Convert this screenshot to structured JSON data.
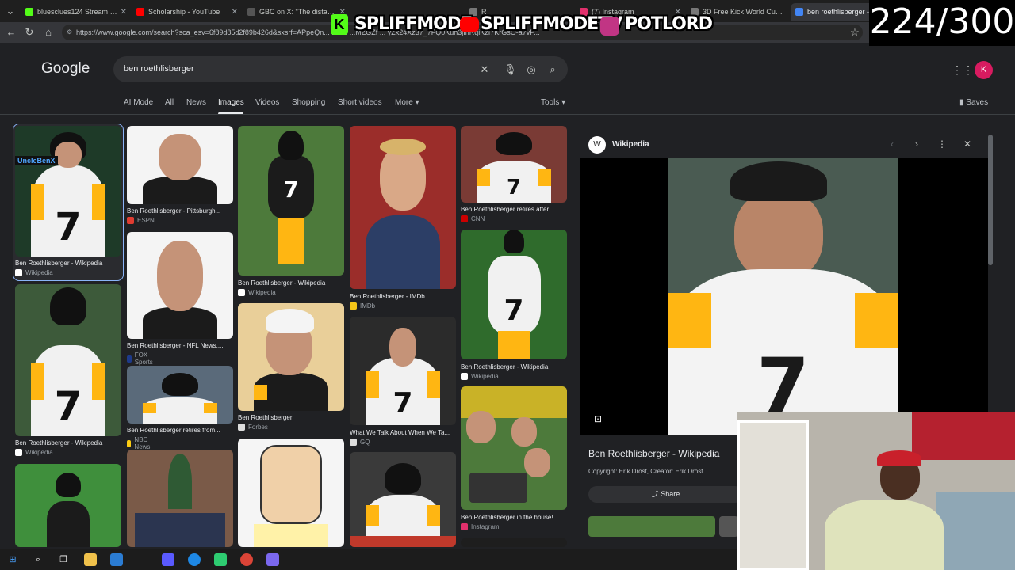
{
  "browser": {
    "tabs": [
      {
        "label": "bluesclues124 Stream - Wa",
        "color": "#53fc18"
      },
      {
        "label": "Scholarship - YouTube",
        "color": "#ff0000"
      },
      {
        "label": "GBC on X: \"The distance b",
        "color": "#ffffff"
      },
      {
        "label": "R",
        "color": "#9aa0a6"
      },
      {
        "label": "(7) Instagram",
        "color": "#e1306c"
      },
      {
        "label": "3D Free Kick World Cup 18",
        "color": "#9aa0a6"
      },
      {
        "label": "ben roethlisberger - Goog",
        "color": "#4285f4"
      }
    ],
    "url": "https://www.google.com/search?sca_esv=6f89d85d2f89b426d&sxsrf=APpeQn... 1785 ...MZGZf ... yZk24Xz37_7FQ0Kuh3jfnRqiKzI7KrGsO-a7vP..."
  },
  "overlay": {
    "logo1": "SPLIFFMODE",
    "logo2": "SPLIFFMODETV",
    "logo3": "POTLORD",
    "counter": "224/300"
  },
  "google": {
    "logo": "Google",
    "query": "ben roethlisberger",
    "avatar_letter": "K",
    "tabs": [
      "AI Mode",
      "All",
      "News",
      "Images",
      "Videos",
      "Shopping",
      "Short videos",
      "More"
    ],
    "tools": "Tools",
    "saves": "Saves"
  },
  "results": [
    {
      "title": "Ben Roethlisberger - Wikipedia",
      "source": "Wikipedia",
      "badge": "UncleBenX"
    },
    {
      "title": "Ben Roethlisberger - Wikipedia",
      "source": "Wikipedia"
    },
    {
      "title": "Ben Roethlisberger - Pittsburgh...",
      "source": "ESPN"
    },
    {
      "title": "Ben Roethlisberger - NFL News,...",
      "source": "FOX Sports"
    },
    {
      "title": "Ben Roethlisberger retires from...",
      "source": "NBC News"
    },
    {
      "title": "Ben Roethlisberger - Wikipedia",
      "source": "Wikipedia"
    },
    {
      "title": "Ben Roethlisberger",
      "source": "Forbes"
    },
    {
      "title": "Ben Roethlisberger - IMDb",
      "source": "IMDb"
    },
    {
      "title": "What We Talk About When We Ta...",
      "source": "GQ"
    },
    {
      "title": "Ben Roethlisberger retires after...",
      "source": "CNN"
    },
    {
      "title": "Ben Roethlisberger - Wikipedia",
      "source": "Wikipedia"
    },
    {
      "title": "Ben Roethlisberger in the house!...",
      "source": "Instagram"
    }
  ],
  "panel": {
    "source": "Wikipedia",
    "fav_letter": "W",
    "title": "Ben Roethlisberger - Wikipedia",
    "copyright": "Copyright: Erik Drost, Creator: Erik Drost",
    "share": "Share",
    "jersey_number": "7"
  }
}
